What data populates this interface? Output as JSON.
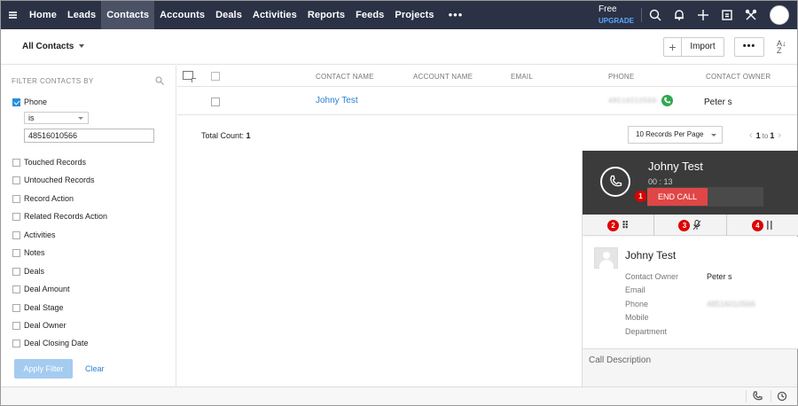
{
  "nav": {
    "items": [
      "Home",
      "Leads",
      "Contacts",
      "Accounts",
      "Deals",
      "Activities",
      "Reports",
      "Feeds",
      "Projects"
    ],
    "active": "Contacts",
    "more": "•••",
    "plan": "Free",
    "upgrade": "UPGRADE",
    "icons": [
      "search-icon",
      "bell-icon",
      "plus-icon",
      "calendar-icon",
      "tools-icon"
    ]
  },
  "toolbar": {
    "view": "All Contacts",
    "plus": "+",
    "import": "Import",
    "more": "•••",
    "sort_top": "A",
    "sort_bottom": "Z"
  },
  "filter": {
    "title": "FILTER CONTACTS BY",
    "phone_label": "Phone",
    "operator": "is",
    "value": "48516010566",
    "options": [
      "Touched Records",
      "Untouched Records",
      "Record Action",
      "Related Records Action",
      "Activities",
      "Notes",
      "Deals",
      "Deal Amount",
      "Deal Stage",
      "Deal Owner",
      "Deal Closing Date"
    ],
    "apply": "Apply Filter",
    "clear": "Clear"
  },
  "table": {
    "headers": [
      "CONTACT NAME",
      "ACCOUNT NAME",
      "EMAIL",
      "PHONE",
      "CONTACT OWNER"
    ],
    "rows": [
      {
        "contact_name": "Johny Test",
        "account_name": "",
        "email": "",
        "phone": "48516010566",
        "owner": "Peter s"
      }
    ],
    "total_label": "Total Count:",
    "total": "1",
    "per_page": "10 Records Per Page",
    "page_from": "1",
    "page_to_label": "to",
    "page_to": "1"
  },
  "call": {
    "name": "Johny Test",
    "time": "00 : 13",
    "end_call": "END CALL",
    "badges": [
      "1",
      "2",
      "3",
      "4"
    ],
    "card": {
      "name": "Johny Test",
      "fields": [
        "Contact Owner",
        "Email",
        "Phone",
        "Mobile",
        "Department"
      ],
      "owner": "Peter s",
      "phone": "48516010566"
    },
    "description_label": "Call Description"
  },
  "colors": {
    "nav_bg": "#2b3245",
    "accent": "#2a7fd0",
    "end_call": "#e04646",
    "badge": "#dd0000"
  }
}
